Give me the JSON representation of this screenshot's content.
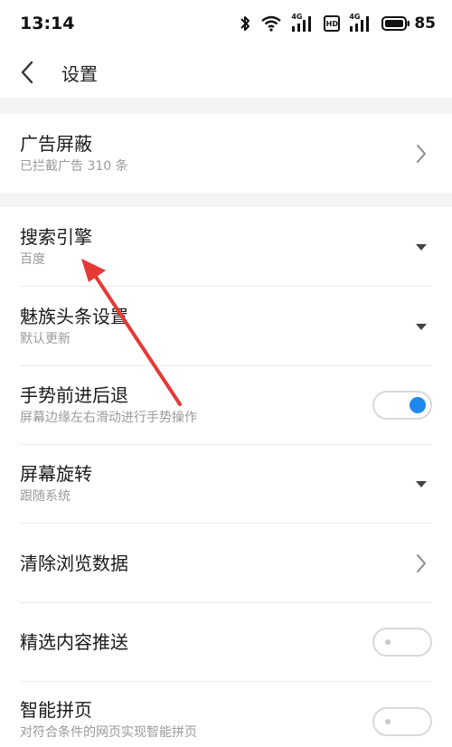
{
  "status_bar": {
    "time": "13:14",
    "battery_percent": "85",
    "net_label_1": "4G",
    "net_label_2": "HD",
    "net_label_3": "4G"
  },
  "header": {
    "title": "设置"
  },
  "settings": {
    "ad_block": {
      "title": "广告屏蔽",
      "subtitle": "已拦截广告 310 条"
    },
    "search_engine": {
      "title": "搜索引擎",
      "subtitle": "百度"
    },
    "meizu_headlines": {
      "title": "魅族头条设置",
      "subtitle": "默认更新"
    },
    "gesture_nav": {
      "title": "手势前进后退",
      "subtitle": "屏幕边缘左右滑动进行手势操作",
      "enabled": true
    },
    "screen_rotation": {
      "title": "屏幕旋转",
      "subtitle": "跟随系统"
    },
    "clear_data": {
      "title": "清除浏览数据"
    },
    "featured_push": {
      "title": "精选内容推送",
      "enabled": false
    },
    "smart_paging": {
      "title": "智能拼页",
      "subtitle": "对符合条件的网页实现智能拼页",
      "enabled": false
    }
  },
  "colors": {
    "accent": "#1e88f0",
    "annotation": "#e53935",
    "separator": "#f4f4f4"
  },
  "icons": {
    "back": "chevron-left-icon",
    "nav": "chevron-right-icon",
    "dropdown": "triangle-down-icon"
  }
}
